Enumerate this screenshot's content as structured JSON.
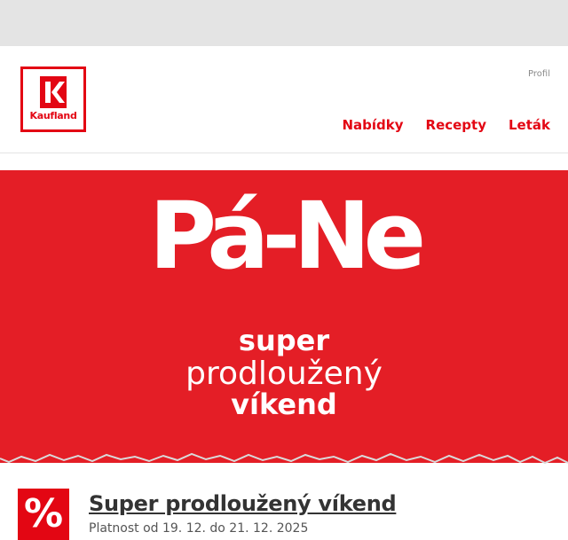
{
  "header": {
    "logo_text": "Kaufland",
    "profile_label": "Profil",
    "nav": [
      {
        "label": "Nabídky"
      },
      {
        "label": "Recepty"
      },
      {
        "label": "Leták"
      }
    ]
  },
  "banner": {
    "headline": "Pá-Ne",
    "line1": "super",
    "line2": "prodloužený",
    "line3": "víkend"
  },
  "offer": {
    "badge_icon": "percent-icon",
    "badge_glyph": "%",
    "title": "Super prodloužený víkend",
    "validity": "Platnost od 19. 12. do 21. 12. 2025"
  },
  "colors": {
    "brand_red": "#e30613",
    "banner_red": "#e41e26",
    "topbar_gray": "#e4e4e4"
  }
}
